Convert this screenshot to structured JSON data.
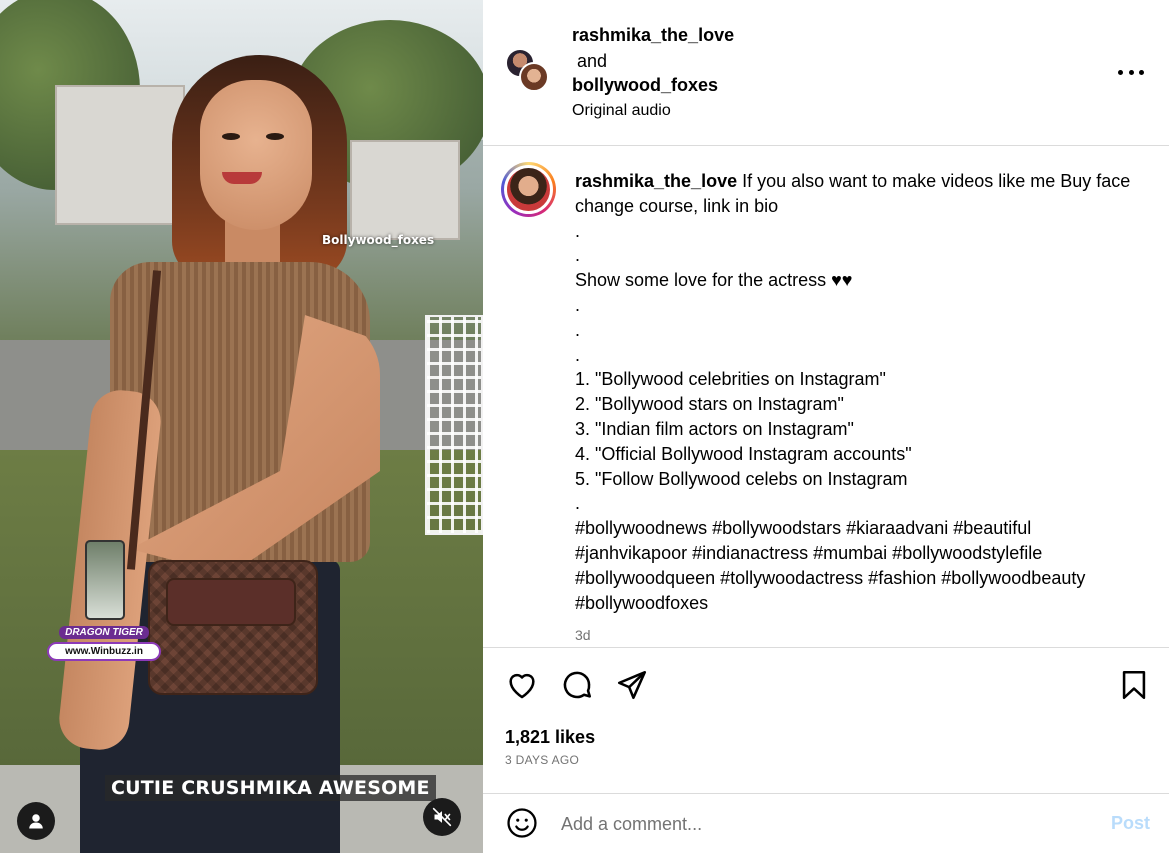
{
  "media": {
    "watermark": "Bollywood_foxes",
    "ad_badge": {
      "title": "DRAGON TIGER",
      "url": "www.Winbuzz.in"
    },
    "caption_overlay": "CUTIE CRUSHMIKA AWESOME",
    "icons": {
      "user": "user-icon",
      "mute": "mute-icon"
    }
  },
  "header": {
    "user1": "rashmika_the_love",
    "conjunction": "and",
    "user2": "bollywood_foxes",
    "audio": "Original audio",
    "more_icon": "more-options-icon"
  },
  "post": {
    "username": "rashmika_the_love",
    "caption_first": " If you also want to make videos like me Buy face change course, link in bio",
    "caption_lines": [
      ".",
      ".",
      "Show some love for the actress ♥♥",
      ".",
      ".",
      ".",
      "1. \"Bollywood celebrities on Instagram\"",
      "2. \"Bollywood stars on Instagram\"",
      "3. \"Indian film actors on Instagram\"",
      "4. \"Official Bollywood Instagram accounts\"",
      "5. \"Follow Bollywood celebs on Instagram",
      ".",
      "#bollywoodnews #bollywoodstars #kiaraadvani #beautiful #janhvikapoor #indianactress #mumbai #bollywoodstylefile #bollywoodqueen #tollywoodactress #fashion #bollywoodbeauty #bollywoodfoxes"
    ],
    "time_ago": "3d"
  },
  "actions": {
    "icons": [
      "heart-icon",
      "comment-icon",
      "share-icon",
      "bookmark-icon"
    ],
    "likes": "1,821 likes",
    "date": "3 DAYS AGO"
  },
  "comment": {
    "placeholder": "Add a comment...",
    "post_label": "Post",
    "emoji_icon": "emoji-icon"
  },
  "colors": {
    "link_disabled": "#b9dcfb",
    "secondary_text": "#737373",
    "divider": "#dbdbdb"
  }
}
